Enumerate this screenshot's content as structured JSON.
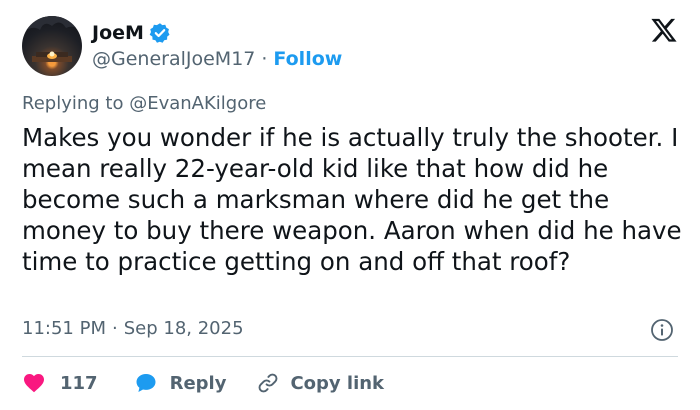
{
  "author": {
    "name": "JoeM",
    "handle": "@GeneralJoeM17",
    "separator": "·",
    "follow_label": "Follow",
    "verified": true
  },
  "reply_context": {
    "prefix": "Replying to",
    "mention": "@EvanAKilgore"
  },
  "tweet": {
    "text": "Makes you wonder if he is actually truly the shooter. I mean really 22-year-old kid like that how did he become such a marksman where did he get the money to buy there weapon. Aaron when did he have time to practice getting on and off that roof?",
    "time": "11:51 PM",
    "date_separator": "·",
    "date": "Sep 18, 2025"
  },
  "actions": {
    "like_count": "117",
    "reply_label": "Reply",
    "copy_link_label": "Copy link"
  },
  "icons": {
    "brand": "x-logo-icon",
    "verified": "verified-badge-icon",
    "info": "info-icon",
    "like": "heart-icon",
    "reply": "speech-bubble-icon",
    "copy": "link-icon"
  },
  "colors": {
    "accent": "#1d9bf0",
    "like": "#f91880",
    "text": "#0f1419",
    "muted": "#536471",
    "divider": "#cfd9de"
  }
}
